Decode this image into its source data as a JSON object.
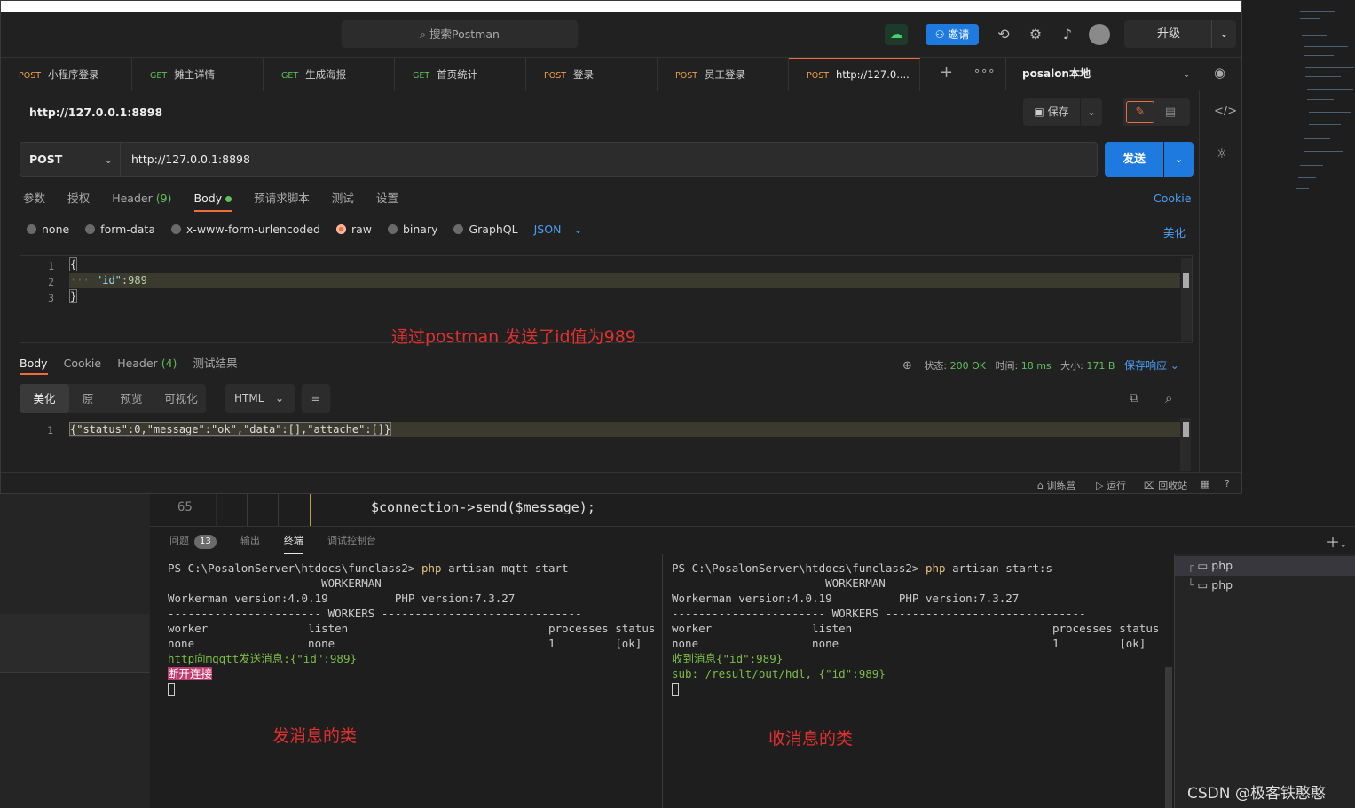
{
  "vscode": {
    "code_line_number": "65",
    "code_line": "$connection->send($message);",
    "panel_tabs": [
      {
        "label": "问题",
        "badge": "13"
      },
      {
        "label": "输出"
      },
      {
        "label": "终端"
      },
      {
        "label": "调试控制台"
      }
    ],
    "terminal_left": {
      "prompt": "PS C:\\PosalonServer\\htdocs\\funclass2> ",
      "cmd_php": "php",
      "cmd_rest": " artisan mqtt start",
      "line_sep1": "---------------------- WORKERMAN ----------------------------",
      "line_version": "Workerman version:4.0.19          PHP version:7.3.27",
      "line_sep2": "----------------------- WORKERS ------------------------------",
      "line_head": "worker               listen                              processes status",
      "line_row": "none                 none                                1         [ok]",
      "msg1": "http向mqqtt发送消息:{\"id\":989}",
      "msg2": "断开连接"
    },
    "terminal_right": {
      "prompt": "PS C:\\PosalonServer\\htdocs\\funclass2> ",
      "cmd_php": "php",
      "cmd_rest": " artisan start:s",
      "line_sep1": "---------------------- WORKERMAN ----------------------------",
      "line_version": "Workerman version:4.0.19          PHP version:7.3.27",
      "line_sep2": "----------------------- WORKERS ------------------------------",
      "line_head": "worker               listen                              processes status",
      "line_row": "none                 none                                1         [ok]",
      "msg1": "收到消息{\"id\":989}",
      "msg2": "sub: /result/out/hdl, {\"id\":989}"
    },
    "terminal_list": [
      "php",
      "php"
    ],
    "annotations": {
      "sender": "发消息的类",
      "receiver": "收消息的类",
      "postman_note": "通过postman 发送了id值为989"
    },
    "watermark": "CSDN @极客铁憨憨"
  },
  "postman": {
    "search_placeholder": "搜索Postman",
    "invite_label": "邀请",
    "upgrade_label": "升级",
    "tabs": [
      {
        "method": "POST",
        "name": "小程序登录"
      },
      {
        "method": "GET",
        "name": "摊主详情"
      },
      {
        "method": "GET",
        "name": "生成海报"
      },
      {
        "method": "GET",
        "name": "首页统计"
      },
      {
        "method": "POST",
        "name": "登录"
      },
      {
        "method": "POST",
        "name": "员工登录"
      },
      {
        "method": "POST",
        "name": "http://127.0...."
      }
    ],
    "environment": "posalon本地",
    "request_title": "http://127.0.0.1:8898",
    "save_label": "保存",
    "method": "POST",
    "url": "http://127.0.0.1:8898",
    "send_label": "发送",
    "subtabs": {
      "params": "参数",
      "auth": "授权",
      "header": "Header",
      "header_count": "(9)",
      "body": "Body",
      "pre": "预请求脚本",
      "tests": "测试",
      "settings": "设置"
    },
    "cookie_link": "Cookie",
    "body_options": [
      "none",
      "form-data",
      "x-www-form-urlencoded",
      "raw",
      "binary",
      "GraphQL"
    ],
    "body_format": "JSON",
    "beautify_label": "美化",
    "body_lines": [
      {
        "n": "1",
        "text": "{"
      },
      {
        "n": "2",
        "key": "\"id\"",
        "val": ":989"
      },
      {
        "n": "3",
        "text": "}"
      }
    ],
    "response": {
      "tabs": {
        "body": "Body",
        "cookie": "Cookie",
        "header": "Header",
        "header_count": "(4)",
        "tests": "测试结果"
      },
      "status_label": "状态:",
      "status_value": "200 OK",
      "time_label": "时间:",
      "time_value": "18 ms",
      "size_label": "大小:",
      "size_value": "171 B",
      "save_label": "保存响应",
      "view_tabs": [
        "美化",
        "原",
        "预览",
        "可视化"
      ],
      "format": "HTML",
      "line_no": "1",
      "line": "{\"status\":0,\"message\":\"ok\",\"data\":[],\"attache\":[]}"
    },
    "footer": {
      "training": "训练营",
      "runner": "运行",
      "trash": "回收站"
    }
  }
}
